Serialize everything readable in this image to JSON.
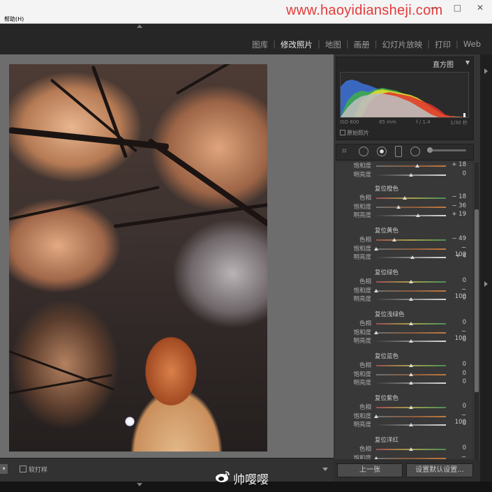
{
  "menubar": {
    "help": "帮助(H)",
    "watermark": "www.haoyidiansheji.com"
  },
  "window_controls": {
    "minimize": "—",
    "maximize": "□",
    "close": "✕"
  },
  "modules": [
    {
      "label": "图库",
      "active": false
    },
    {
      "label": "修改照片",
      "active": true
    },
    {
      "label": "地图",
      "active": false
    },
    {
      "label": "画册",
      "active": false
    },
    {
      "label": "幻灯片放映",
      "active": false
    },
    {
      "label": "打印",
      "active": false
    },
    {
      "label": "Web",
      "active": false
    }
  ],
  "histogram": {
    "title": "直方图",
    "iso": "ISO 800",
    "focal": "85 mm",
    "aperture": "f / 1.4",
    "shutter": "1/30 秒",
    "original_photo_label": "原始照片"
  },
  "tools": [
    "crop-icon",
    "spot-removal-icon",
    "red-eye-icon",
    "graduated-filter-icon",
    "radial-filter-icon",
    "adjustment-brush-icon"
  ],
  "hsl": {
    "partial_rows": [
      {
        "label": "饱和度",
        "value": "+ 18",
        "pos": 0.59
      },
      {
        "label": "明亮度",
        "value": "0",
        "pos": 0.5
      }
    ],
    "groups": [
      {
        "title": "复位橙色",
        "rows": [
          {
            "label": "色相",
            "value": "− 18",
            "pos": 0.41
          },
          {
            "label": "饱和度",
            "value": "− 36",
            "pos": 0.32
          },
          {
            "label": "明亮度",
            "value": "+ 19",
            "pos": 0.595
          }
        ]
      },
      {
        "title": "复位黄色",
        "rows": [
          {
            "label": "色相",
            "value": "− 49",
            "pos": 0.255
          },
          {
            "label": "饱和度",
            "value": "− 100",
            "pos": 0.0
          },
          {
            "label": "明亮度",
            "value": "+ 4",
            "pos": 0.52
          }
        ]
      },
      {
        "title": "复位绿色",
        "rows": [
          {
            "label": "色相",
            "value": "0",
            "pos": 0.5
          },
          {
            "label": "饱和度",
            "value": "− 100",
            "pos": 0.0
          },
          {
            "label": "明亮度",
            "value": "0",
            "pos": 0.5
          }
        ]
      },
      {
        "title": "复位浅绿色",
        "rows": [
          {
            "label": "色相",
            "value": "0",
            "pos": 0.5
          },
          {
            "label": "饱和度",
            "value": "− 100",
            "pos": 0.0
          },
          {
            "label": "明亮度",
            "value": "0",
            "pos": 0.5
          }
        ]
      },
      {
        "title": "复位蓝色",
        "rows": [
          {
            "label": "色相",
            "value": "0",
            "pos": 0.5
          },
          {
            "label": "饱和度",
            "value": "0",
            "pos": 0.5
          },
          {
            "label": "明亮度",
            "value": "0",
            "pos": 0.5
          }
        ]
      },
      {
        "title": "复位紫色",
        "rows": [
          {
            "label": "色相",
            "value": "0",
            "pos": 0.5
          },
          {
            "label": "饱和度",
            "value": "− 100",
            "pos": 0.0
          },
          {
            "label": "明亮度",
            "value": "0",
            "pos": 0.5
          }
        ]
      },
      {
        "title": "复位洋红",
        "rows": [
          {
            "label": "色相",
            "value": "0",
            "pos": 0.5
          },
          {
            "label": "饱和度",
            "value": "− 100",
            "pos": 0.0
          }
        ]
      }
    ]
  },
  "panel_buttons": {
    "previous": "上一张",
    "reset_default": "设置默认设置..."
  },
  "viewer_toolbar": {
    "soft_proof": "软打样"
  },
  "weibo": "帅嘤嘤",
  "colors": {
    "accent_watermark": "#e43a3a",
    "panel_bg": "#383838",
    "viewer_bg": "#6d6d6d"
  }
}
